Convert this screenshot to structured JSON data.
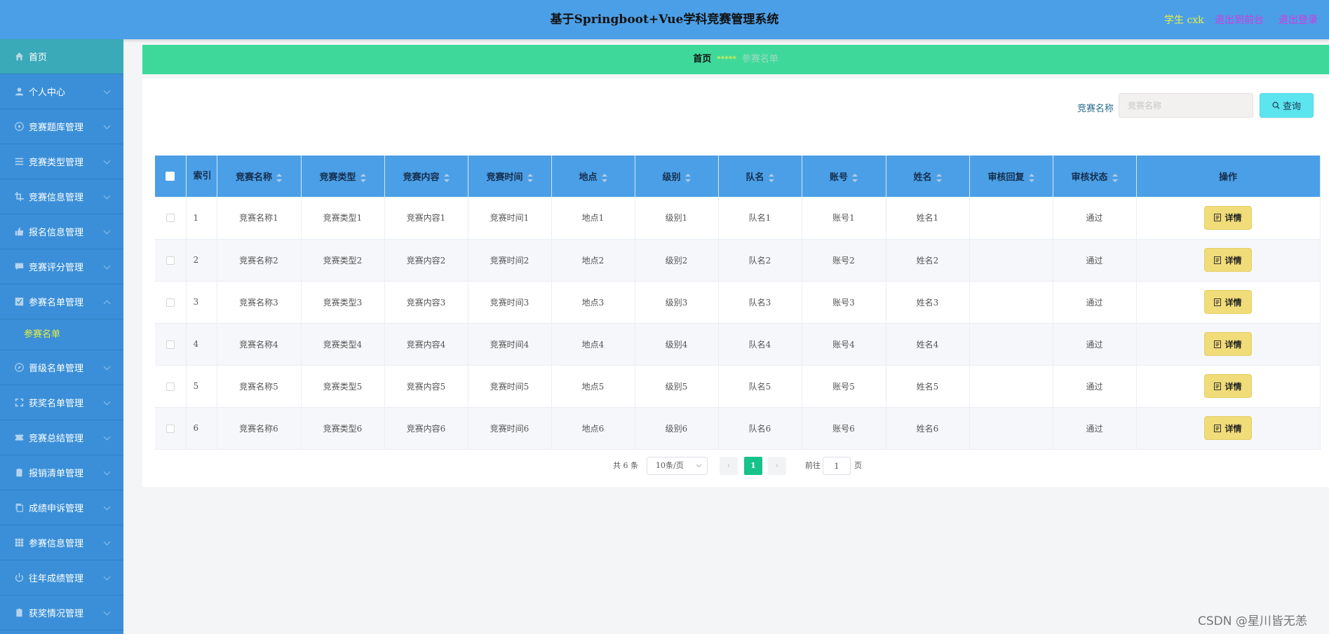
{
  "header": {
    "title": "基于Springboot+Vue学科竞赛管理系统",
    "role_user": "学生 cxk",
    "back_to_front": "退出到前台",
    "logout": "退出登录"
  },
  "sidebar": {
    "items": [
      {
        "label": "首页",
        "icon": "home-icon"
      },
      {
        "label": "个人中心",
        "icon": "user-icon"
      },
      {
        "label": "竞赛题库管理",
        "icon": "target-icon"
      },
      {
        "label": "竞赛类型管理",
        "icon": "list-icon"
      },
      {
        "label": "竞赛信息管理",
        "icon": "crop-icon"
      },
      {
        "label": "报名信息管理",
        "icon": "thumb-icon"
      },
      {
        "label": "竞赛评分管理",
        "icon": "comment-icon"
      },
      {
        "label": "参赛名单管理",
        "icon": "checkbox-icon"
      },
      {
        "label": "晋级名单管理",
        "icon": "compass-icon"
      },
      {
        "label": "获奖名单管理",
        "icon": "fullscreen-icon"
      },
      {
        "label": "竞赛总结管理",
        "icon": "ticket-icon"
      },
      {
        "label": "报销清单管理",
        "icon": "clipboard-icon"
      },
      {
        "label": "成绩申诉管理",
        "icon": "copy-icon"
      },
      {
        "label": "参赛信息管理",
        "icon": "grid-icon"
      },
      {
        "label": "往年成绩管理",
        "icon": "power-icon"
      },
      {
        "label": "获奖情况管理",
        "icon": "clipboard-icon"
      }
    ],
    "submenu": {
      "label": "参赛名单"
    }
  },
  "breadcrumb": {
    "home": "首页",
    "separator": "*****",
    "current": "参赛名单"
  },
  "search": {
    "label": "竞赛名称",
    "placeholder": "竞赛名称",
    "button": "查询"
  },
  "table": {
    "columns": [
      "索引",
      "竞赛名称",
      "竞赛类型",
      "竞赛内容",
      "竞赛时间",
      "地点",
      "级别",
      "队名",
      "账号",
      "姓名",
      "审核回复",
      "审核状态",
      "操作"
    ],
    "rows": [
      [
        "1",
        "竞赛名称1",
        "竞赛类型1",
        "竞赛内容1",
        "竞赛时间1",
        "地点1",
        "级别1",
        "队名1",
        "账号1",
        "姓名1",
        "",
        "通过"
      ],
      [
        "2",
        "竞赛名称2",
        "竞赛类型2",
        "竞赛内容2",
        "竞赛时间2",
        "地点2",
        "级别2",
        "队名2",
        "账号2",
        "姓名2",
        "",
        "通过"
      ],
      [
        "3",
        "竞赛名称3",
        "竞赛类型3",
        "竞赛内容3",
        "竞赛时间3",
        "地点3",
        "级别3",
        "队名3",
        "账号3",
        "姓名3",
        "",
        "通过"
      ],
      [
        "4",
        "竞赛名称4",
        "竞赛类型4",
        "竞赛内容4",
        "竞赛时间4",
        "地点4",
        "级别4",
        "队名4",
        "账号4",
        "姓名4",
        "",
        "通过"
      ],
      [
        "5",
        "竞赛名称5",
        "竞赛类型5",
        "竞赛内容5",
        "竞赛时间5",
        "地点5",
        "级别5",
        "队名5",
        "账号5",
        "姓名5",
        "",
        "通过"
      ],
      [
        "6",
        "竞赛名称6",
        "竞赛类型6",
        "竞赛内容6",
        "竞赛时间6",
        "地点6",
        "级别6",
        "队名6",
        "账号6",
        "姓名6",
        "",
        "通过"
      ]
    ],
    "action_label": "详情"
  },
  "pagination": {
    "total": "共 6 条",
    "page_size": "10条/页",
    "current_page": "1",
    "goto_label": "前往",
    "goto_value": "1",
    "goto_unit": "页"
  },
  "watermark": "CSDN @星川皆无恙",
  "colors": {
    "header_bg": "#4b9fe6",
    "sidebar_bg": "#3a8fd8",
    "breadcrumb_bg": "#3ed99a",
    "detail_button": "#f0dc79",
    "search_button": "#5ce4ef",
    "active_page": "#17c38a"
  }
}
